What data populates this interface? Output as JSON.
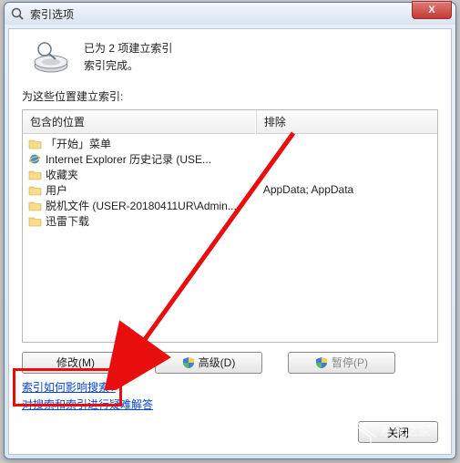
{
  "window": {
    "title": "索引选项",
    "close_x": "X"
  },
  "status": {
    "line1": "已为 2 项建立索引",
    "line2": "索引完成。"
  },
  "section_label": "为这些位置建立索引:",
  "columns": {
    "included": "包含的位置",
    "excluded": "排除"
  },
  "included_items": [
    {
      "label": "「开始」菜单",
      "icon": "folder"
    },
    {
      "label": "Internet Explorer 历史记录 (USE...",
      "icon": "ie"
    },
    {
      "label": "收藏夹",
      "icon": "folder"
    },
    {
      "label": "用户",
      "icon": "folder"
    },
    {
      "label": "脱机文件 (USER-20180411UR\\Admin...",
      "icon": "folder"
    },
    {
      "label": "迅雷下载",
      "icon": "folder"
    }
  ],
  "excluded_items": [
    {
      "label": "",
      "blank": true
    },
    {
      "label": "",
      "blank": true
    },
    {
      "label": "",
      "blank": true
    },
    {
      "label": "AppData; AppData",
      "blank": false
    }
  ],
  "buttons": {
    "modify": "修改(M)",
    "advanced": "高级(D)",
    "pause": "暂停(P)"
  },
  "links": {
    "link1": "索引如何影响搜索?",
    "link2": "对搜索和索引进行疑难解答"
  },
  "close_label": "关闭"
}
